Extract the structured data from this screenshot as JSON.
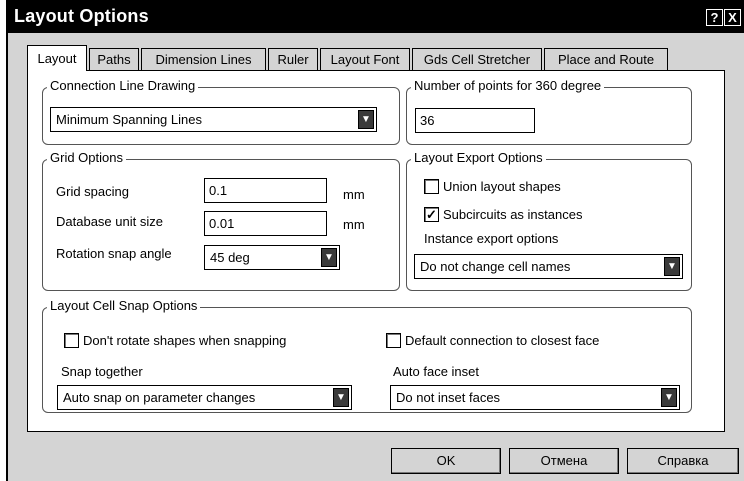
{
  "window": {
    "title": "Layout Options",
    "help_label": "?",
    "close_label": "X"
  },
  "tabs": [
    "Layout",
    "Paths",
    "Dimension Lines",
    "Ruler",
    "Layout Font",
    "Gds Cell Stretcher",
    "Place and Route"
  ],
  "active_tab": "Layout",
  "connection_line": {
    "legend": "Connection Line Drawing",
    "selected": "Minimum Spanning Lines"
  },
  "points360": {
    "legend": "Number of points for 360 degree",
    "value": "36"
  },
  "grid": {
    "legend": "Grid Options",
    "spacing_label": "Grid spacing",
    "spacing_value": "0.1",
    "spacing_unit": "mm",
    "dbunit_label": "Database unit size",
    "dbunit_value": "0.01",
    "dbunit_unit": "mm",
    "rotation_label": "Rotation snap angle",
    "rotation_value": "45 deg"
  },
  "export": {
    "legend": "Layout Export Options",
    "union_label": "Union layout shapes",
    "union_checked": false,
    "subcircuits_label": "Subcircuits as instances",
    "subcircuits_checked": true,
    "instance_label": "Instance export options",
    "instance_selected": "Do not change cell names"
  },
  "snap": {
    "legend": "Layout Cell Snap Options",
    "dont_rotate_label": "Don't rotate shapes when snapping",
    "dont_rotate_checked": false,
    "default_conn_label": "Default connection to closest face",
    "default_conn_checked": false,
    "snap_together_label": "Snap together",
    "snap_together_selected": "Auto snap on parameter changes",
    "auto_face_label": "Auto face inset",
    "auto_face_selected": "Do not inset faces"
  },
  "buttons": {
    "ok": "OK",
    "cancel": "Отмена",
    "help": "Справка"
  }
}
